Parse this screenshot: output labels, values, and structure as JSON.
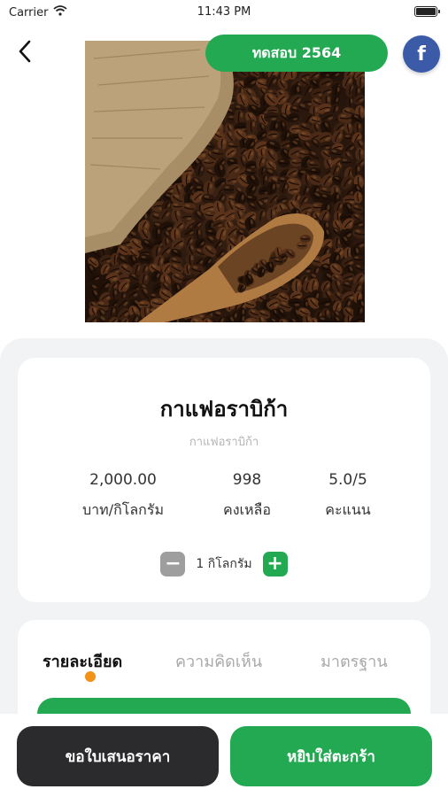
{
  "status_bar": {
    "carrier": "Carrier",
    "time": "11:43 PM"
  },
  "header": {
    "back_icon": "chevron-left-icon",
    "tag_label": "ทดสอบ 2564",
    "facebook_icon": "facebook-icon",
    "facebook_glyph": "f",
    "image_subject": "coffee-beans"
  },
  "product": {
    "title": "กาแฟอราบิก้า",
    "subtitle": "กาแฟอราบิก้า",
    "stats": [
      {
        "value": "2,000.00",
        "label": "บาท/กิโลกรัม"
      },
      {
        "value": "998",
        "label": "คงเหลือ"
      },
      {
        "value": "5.0/5",
        "label": "คะแนน"
      }
    ],
    "quantity": {
      "minus_glyph": "−",
      "plus_glyph": "+",
      "value": "1",
      "unit": "กิโลกรัม",
      "text": "1 กิโลกรัม"
    }
  },
  "tabs": {
    "items": [
      "รายละเอียด",
      "ความคิดเห็น",
      "มาตรฐาน"
    ],
    "active_index": 0
  },
  "actions": {
    "quote_label": "ขอใบเสนอราคา",
    "cart_label": "หยิบใส่ตะกร้า"
  },
  "colors": {
    "primary_green": "#22a952",
    "dark_button": "#2b2b2d",
    "facebook_blue": "#3b5aa8",
    "active_tab_dot": "#f39217",
    "sheet_background": "#f2f3f5"
  }
}
